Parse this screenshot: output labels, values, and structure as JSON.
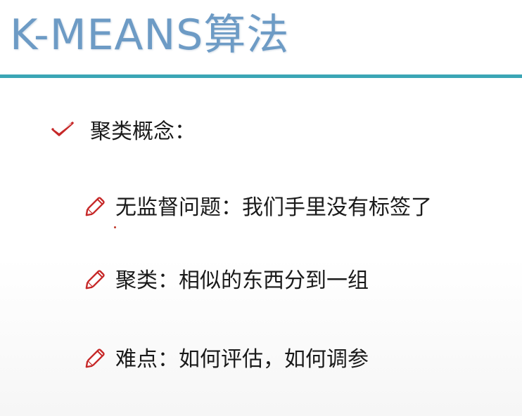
{
  "slide": {
    "title": "K-MEANS算法",
    "title_color": "#6d9bc5",
    "rule_color": "#3aa6b5",
    "bullet": {
      "icon": "check-icon",
      "text": "聚类概念："
    },
    "subitems": [
      {
        "icon": "pencil-icon",
        "text": "无监督问题：我们手里没有标签了"
      },
      {
        "icon": "pencil-icon",
        "text": "聚类：相似的东西分到一组"
      },
      {
        "icon": "pencil-icon",
        "text": "难点：如何评估，如何调参"
      }
    ]
  }
}
